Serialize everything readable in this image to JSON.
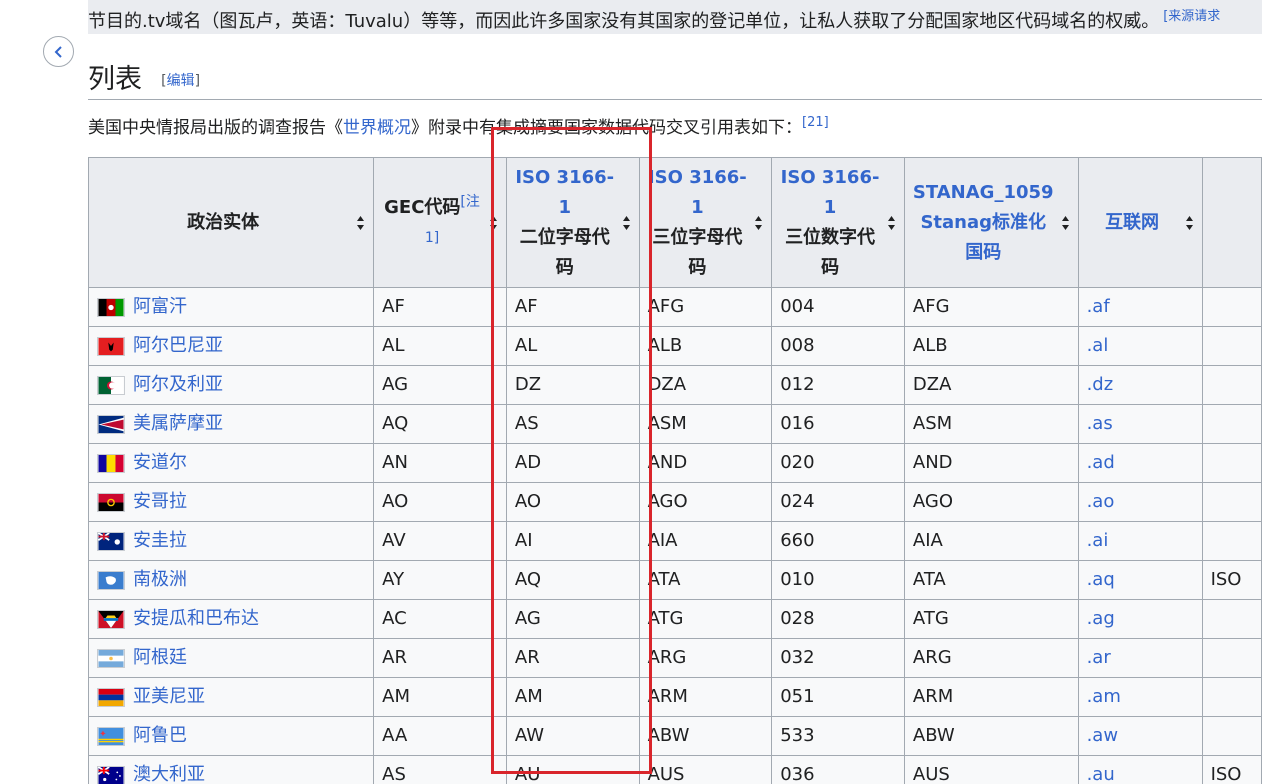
{
  "top_text": {
    "text": "节目的.tv域名（图瓦卢，英语：Tuvalu）等等，而因此许多国家没有其国家的登记单位，让私人获取了分配国家地区代码域名的权威。",
    "citation": "[来源请求"
  },
  "section": {
    "title": "列表",
    "edit_open": "[",
    "edit_label": "编辑",
    "edit_close": "]"
  },
  "intro": {
    "before": "美国中央情报局出版的调查报告《",
    "link": "世界概况",
    "after": "》附录中有集成摘要国家数据代码交叉引用表如下：",
    "ref": "[21]"
  },
  "table": {
    "headers": {
      "entity": "政治实体",
      "gec": "GEC代码",
      "gec_note": "[注 1]",
      "iso2_link": "ISO 3166-1",
      "iso2_sub": "二位字母代码",
      "iso3_link": "ISO 3166-1",
      "iso3_sub": "三位字母代码",
      "isonum_link": "ISO 3166-1",
      "isonum_sub": "三位数字代码",
      "stanag_link": "STANAG_1059 Stanag标准化国码",
      "internet_link": "互联网"
    },
    "rows": [
      {
        "name": "阿富汗",
        "gec": "AF",
        "iso2": "AF",
        "iso3": "AFG",
        "num": "004",
        "stanag": "AFG",
        "tld": ".af",
        "extra": ""
      },
      {
        "name": "阿尔巴尼亚",
        "gec": "AL",
        "iso2": "AL",
        "iso3": "ALB",
        "num": "008",
        "stanag": "ALB",
        "tld": ".al",
        "extra": ""
      },
      {
        "name": "阿尔及利亚",
        "gec": "AG",
        "iso2": "DZ",
        "iso3": "DZA",
        "num": "012",
        "stanag": "DZA",
        "tld": ".dz",
        "extra": ""
      },
      {
        "name": "美属萨摩亚",
        "gec": "AQ",
        "iso2": "AS",
        "iso3": "ASM",
        "num": "016",
        "stanag": "ASM",
        "tld": ".as",
        "extra": ""
      },
      {
        "name": "安道尔",
        "gec": "AN",
        "iso2": "AD",
        "iso3": "AND",
        "num": "020",
        "stanag": "AND",
        "tld": ".ad",
        "extra": ""
      },
      {
        "name": "安哥拉",
        "gec": "AO",
        "iso2": "AO",
        "iso3": "AGO",
        "num": "024",
        "stanag": "AGO",
        "tld": ".ao",
        "extra": ""
      },
      {
        "name": "安圭拉",
        "gec": "AV",
        "iso2": "AI",
        "iso3": "AIA",
        "num": "660",
        "stanag": "AIA",
        "tld": ".ai",
        "extra": ""
      },
      {
        "name": "南极洲",
        "gec": "AY",
        "iso2": "AQ",
        "iso3": "ATA",
        "num": "010",
        "stanag": "ATA",
        "tld": ".aq",
        "extra": "ISO"
      },
      {
        "name": "安提瓜和巴布达",
        "gec": "AC",
        "iso2": "AG",
        "iso3": "ATG",
        "num": "028",
        "stanag": "ATG",
        "tld": ".ag",
        "extra": ""
      },
      {
        "name": "阿根廷",
        "gec": "AR",
        "iso2": "AR",
        "iso3": "ARG",
        "num": "032",
        "stanag": "ARG",
        "tld": ".ar",
        "extra": ""
      },
      {
        "name": "亚美尼亚",
        "gec": "AM",
        "iso2": "AM",
        "iso3": "ARM",
        "num": "051",
        "stanag": "ARM",
        "tld": ".am",
        "extra": ""
      },
      {
        "name": "阿鲁巴",
        "gec": "AA",
        "iso2": "AW",
        "iso3": "ABW",
        "num": "533",
        "stanag": "ABW",
        "tld": ".aw",
        "extra": ""
      },
      {
        "name": "澳大利亚",
        "gec": "AS",
        "iso2": "AU",
        "iso3": "AUS",
        "num": "036",
        "stanag": "AUS",
        "tld": ".au",
        "extra": "ISO"
      }
    ]
  },
  "colors": {
    "link": "#3366cc",
    "text": "#202122",
    "border": "#a2a9b1",
    "header_bg": "#eaecf0",
    "highlight": "#d9252b"
  }
}
